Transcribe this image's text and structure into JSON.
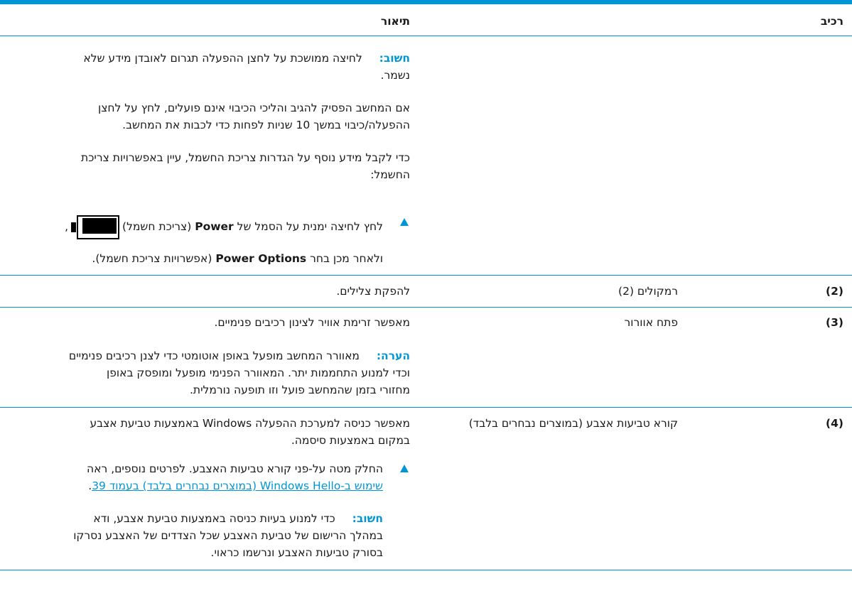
{
  "header": {
    "component": "רכיב",
    "description": "תיאור"
  },
  "row1": {
    "important_label": "חשוב:",
    "important_line1": "לחיצה ממושכת על לחצן ההפעלה תגרום לאובדן מידע שלא",
    "important_line2": "נשמר.",
    "p1_line1": "אם המחשב הפסיק להגיב והליכי הכיבוי אינם פועלים, לחץ על לחצן",
    "p1_line2": "ההפעלה/כיבוי במשך 10 שניות לפחות כדי לכבות את המחשב.",
    "p2_line1": "כדי לקבל מידע נוסף על הגדרות צריכת החשמל, עיין באפשרויות צריכת",
    "p2_line2": "החשמל:",
    "step_pre": "לחץ לחיצה ימנית על הסמל של",
    "step_power": "Power",
    "step_paren": "(צריכת חשמל)",
    "step_comma": ",",
    "step2_pre": "ולאחר מכן בחר",
    "step2_options": "Power Options",
    "step2_paren": "(אפשרויות צריכת חשמל).",
    "battery_icon": "battery-icon"
  },
  "row2": {
    "num": "(2)",
    "component": "רמקולים (2)",
    "description": "להפקת צלילים."
  },
  "row3": {
    "num": "(3)",
    "component": "פתח אוורור",
    "description": "מאפשר זרימת אוויר לצינון רכיבים פנימיים.",
    "note_label": "הערה:",
    "note_line1": "מאוורר המחשב מופעל באופן אוטומטי כדי לצנן רכיבים פנימיים",
    "note_line2": "וכדי למנוע התחממות יתר. המאוורר הפנימי מופעל ומופסק באופן",
    "note_line3": "מחזורי בזמן שהמחשב פועל וזו תופעה נורמלית."
  },
  "row4": {
    "num": "(4)",
    "component": "קורא טביעות אצבע (במוצרים נבחרים בלבד)",
    "desc_line1": "מאפשר כניסה למערכת ההפעלה Windows באמצעות טביעת אצבע",
    "desc_line2": "במקום באמצעות סיסמה.",
    "step_line1": "החלק מטה על-פני קורא טביעות האצבע. לפרטים נוספים, ראה",
    "step_link": "שימוש ב-Windows Hello (במוצרים נבחרים בלבד) בעמוד 39",
    "step_period": ".",
    "important_label": "חשוב:",
    "imp_line1": "כדי למנוע בעיות כניסה באמצעות טביעת אצבע, ודא",
    "imp_line2": "במהלך הרישום של טביעת האצבע שכל הצדדים של האצבע נסרקו",
    "imp_line3": "בסורק טביעות האצבע ונרשמו כראוי."
  },
  "colors": {
    "accent": "#0096d6",
    "text": "#1a1a1a"
  }
}
